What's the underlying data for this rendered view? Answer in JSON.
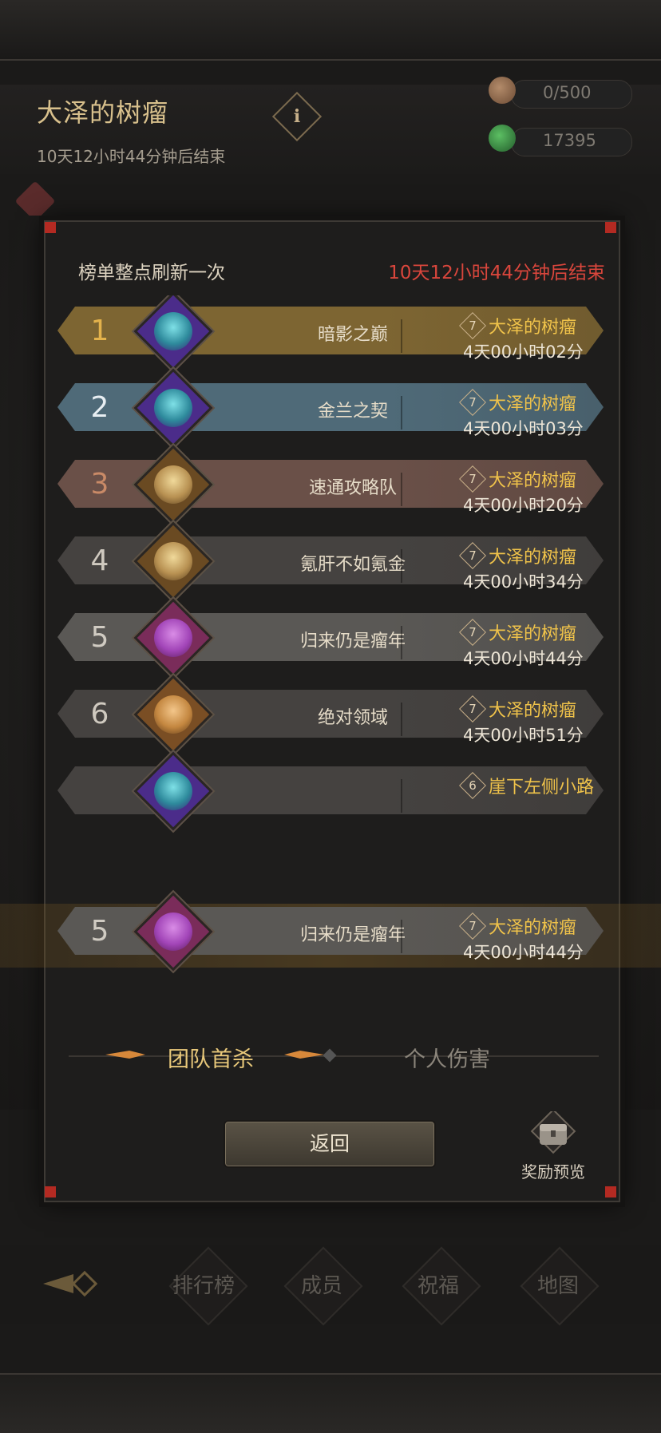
{
  "header": {
    "title": "大泽的树瘤",
    "subtitle": "10天12小时44分钟后结束",
    "info_symbol": "i",
    "resources": [
      {
        "icon": "meat-icon",
        "value": "0/500"
      },
      {
        "icon": "herb-icon",
        "value": "17395"
      }
    ]
  },
  "modal": {
    "hint": "榜单整点刷新一次",
    "timer": "10天12小时44分钟后结束",
    "ranks": [
      {
        "rank": "1",
        "team": "暗影之巅",
        "boss_level": "7",
        "boss": "大泽的树瘤",
        "time": "4天00小时02分",
        "crest": "wizard-crest-icon"
      },
      {
        "rank": "2",
        "team": "金兰之契",
        "boss_level": "7",
        "boss": "大泽的树瘤",
        "time": "4天00小时03分",
        "crest": "wizard-crest-icon"
      },
      {
        "rank": "3",
        "team": "速通攻略队",
        "boss_level": "7",
        "boss": "大泽的树瘤",
        "time": "4天00小时20分",
        "crest": "unicorn-crest-icon"
      },
      {
        "rank": "4",
        "team": "氪肝不如氪金",
        "boss_level": "7",
        "boss": "大泽的树瘤",
        "time": "4天00小时34分",
        "crest": "unicorn-crest-icon"
      },
      {
        "rank": "5",
        "team": "归来仍是瘤年",
        "boss_level": "7",
        "boss": "大泽的树瘤",
        "time": "4天00小时44分",
        "crest": "knight-crest-icon"
      },
      {
        "rank": "6",
        "team": "绝对领域",
        "boss_level": "7",
        "boss": "大泽的树瘤",
        "time": "4天00小时51分",
        "crest": "mask-crest-icon"
      },
      {
        "rank": "",
        "team": "",
        "boss_level": "6",
        "boss": "崖下左侧小路",
        "time": "",
        "crest": "wizard-crest-icon"
      }
    ],
    "my_rank": {
      "rank": "5",
      "team": "归来仍是瘤年",
      "boss_level": "7",
      "boss": "大泽的树瘤",
      "time": "4天00小时44分",
      "crest": "knight-crest-icon"
    },
    "tabs": [
      "团队首杀",
      "个人伤害"
    ],
    "return_label": "返回",
    "reward_label": "奖励预览"
  },
  "bottom_nav": [
    "排行榜",
    "成员",
    "祝福",
    "地图"
  ],
  "colors": {
    "rank1": "#7d6532",
    "rank2": "#4f6a78",
    "rank3": "#6a5048",
    "default_row": "#454240",
    "light_row": "#5a5855",
    "accent_gold": "#f0c34a",
    "timer_red": "#d9463c"
  }
}
